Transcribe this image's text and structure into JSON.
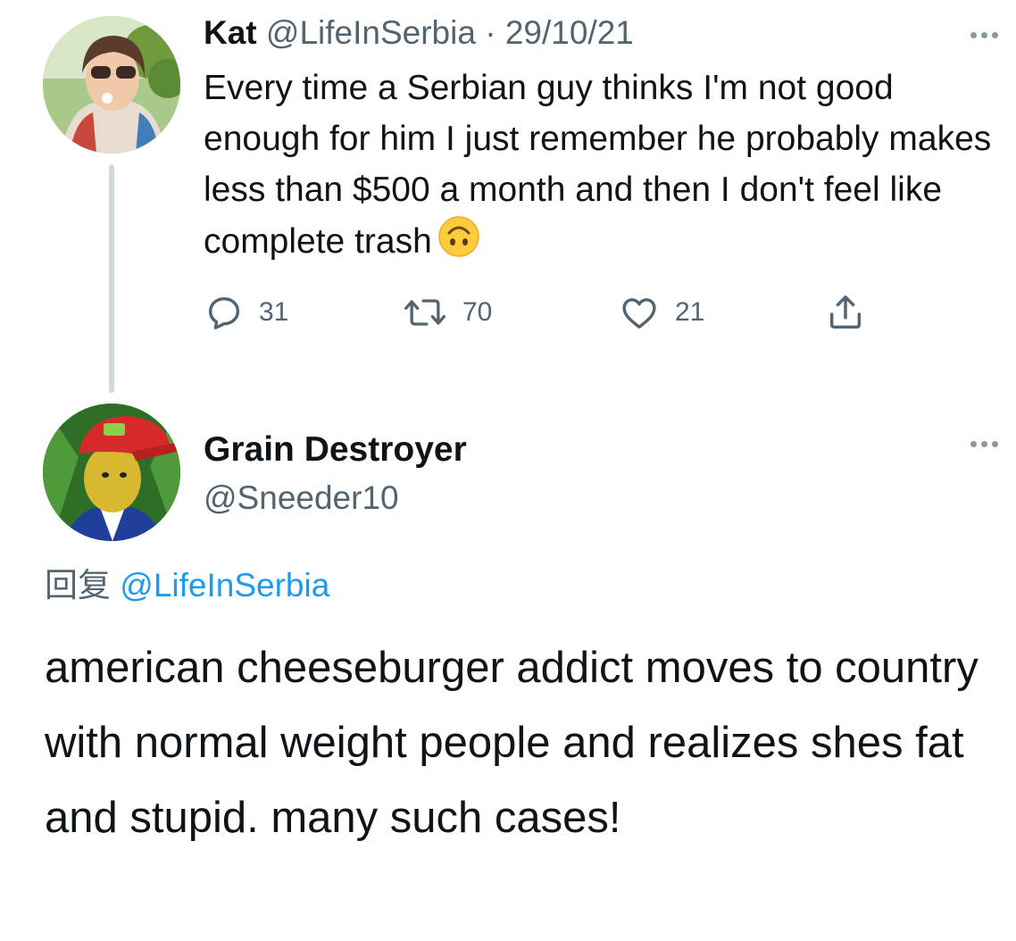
{
  "tweet": {
    "author_name": "Kat",
    "author_handle": "@LifeInSerbia",
    "separator": "·",
    "date": "29/10/21",
    "text": "Every time a Serbian guy thinks I'm not good enough for him I just remember he probably makes less than $500 a month and then I don't feel like complete trash",
    "emoji": "upside-down-face-icon",
    "replies": "31",
    "retweets": "70",
    "likes": "21"
  },
  "reply": {
    "author_name": "Grain Destroyer",
    "author_handle": "@Sneeder10",
    "replying_prefix": "回复",
    "replying_to": "@LifeInSerbia",
    "text": "american cheeseburger addict moves to country with normal weight people and realizes shes fat and stupid. many such cases!"
  },
  "colors": {
    "text": "#0f1419",
    "secondary": "#536471",
    "link": "#1d9bf0",
    "thread_line": "#cfd9de"
  }
}
